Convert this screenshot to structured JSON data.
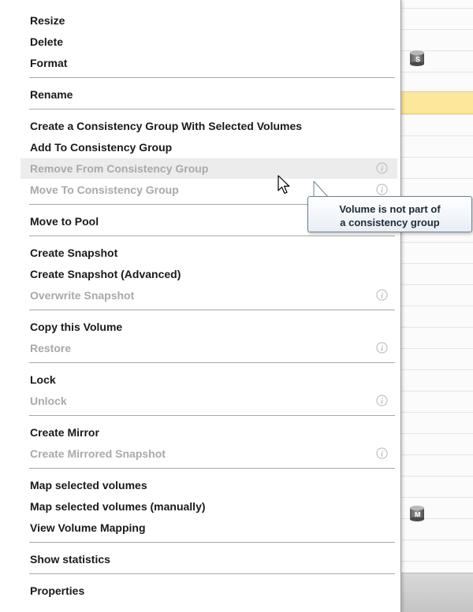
{
  "menu": {
    "groups": [
      [
        {
          "label": "Resize",
          "enabled": true
        },
        {
          "label": "Delete",
          "enabled": true
        },
        {
          "label": "Format",
          "enabled": true
        }
      ],
      [
        {
          "label": "Rename",
          "enabled": true
        }
      ],
      [
        {
          "label": "Create a Consistency Group With Selected Volumes",
          "enabled": true
        },
        {
          "label": "Add To Consistency Group",
          "enabled": true
        },
        {
          "label": "Remove From Consistency Group",
          "enabled": false,
          "info_icon": true,
          "hovered": true
        },
        {
          "label": "Move To Consistency Group",
          "enabled": false,
          "info_icon": true
        }
      ],
      [
        {
          "label": "Move to Pool",
          "enabled": true
        }
      ],
      [
        {
          "label": "Create Snapshot",
          "enabled": true
        },
        {
          "label": "Create Snapshot (Advanced)",
          "enabled": true
        },
        {
          "label": "Overwrite Snapshot",
          "enabled": false,
          "info_icon": true
        }
      ],
      [
        {
          "label": "Copy this Volume",
          "enabled": true
        },
        {
          "label": "Restore",
          "enabled": false,
          "info_icon": true
        }
      ],
      [
        {
          "label": "Lock",
          "enabled": true
        },
        {
          "label": "Unlock",
          "enabled": false,
          "info_icon": true
        }
      ],
      [
        {
          "label": "Create Mirror",
          "enabled": true
        },
        {
          "label": "Create Mirrored Snapshot",
          "enabled": false,
          "info_icon": true
        }
      ],
      [
        {
          "label": "Map selected volumes",
          "enabled": true
        },
        {
          "label": "Map selected volumes (manually)",
          "enabled": true
        },
        {
          "label": "View Volume Mapping",
          "enabled": true
        }
      ],
      [
        {
          "label": "Show statistics",
          "enabled": true
        }
      ],
      [
        {
          "label": "Properties",
          "enabled": true
        }
      ]
    ]
  },
  "tooltip": {
    "line1": "Volume is not part of",
    "line2": "a consistency group"
  },
  "background": {
    "volume_badges": [
      "S",
      "M"
    ],
    "highlight_color": "#fde79a"
  },
  "colors": {
    "enabled_text": "#1a1a1a",
    "disabled_text": "#a9a9a9",
    "hover_bg": "#ececec",
    "separator": "#a8a8a8"
  },
  "icons": {
    "info": "info-icon",
    "cursor": "mouse-cursor-icon",
    "volume": "volume-cylinder-icon"
  }
}
